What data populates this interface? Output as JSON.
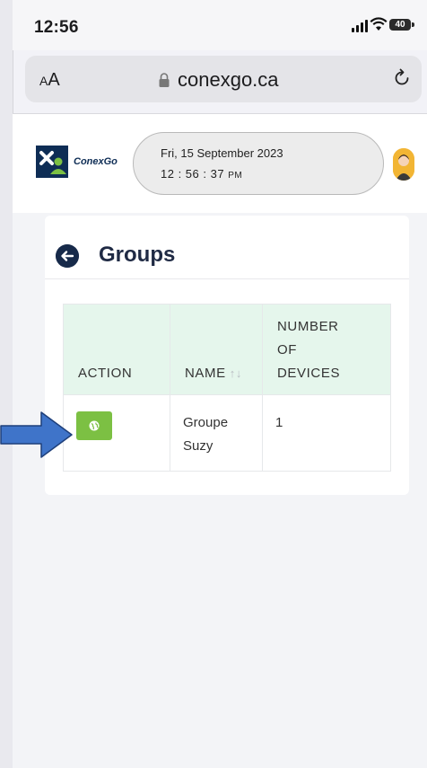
{
  "status_bar": {
    "time": "12:56",
    "battery": "40"
  },
  "browser": {
    "text_size_label_small": "A",
    "text_size_label_large": "A",
    "url": "conexgo.ca"
  },
  "header": {
    "logo_text": "ConexGo",
    "date": "Fri, 15 September 2023",
    "clock": "12 : 56 : 37",
    "meridiem": "PM"
  },
  "page": {
    "title": "Groups",
    "table": {
      "columns": [
        {
          "line1": "ACTION",
          "line2": "",
          "line3": ""
        },
        {
          "line1": "NAME",
          "line2": "",
          "line3": ""
        },
        {
          "line1": "NUMBER",
          "line2": "OF",
          "line3": "DEVICES"
        }
      ],
      "rows": [
        {
          "name_line1": "Groupe",
          "name_line2": "Suzy",
          "devices": "1"
        }
      ]
    }
  },
  "colors": {
    "brand_navy": "#172a4a",
    "header_green": "#e5f6ec",
    "action_green": "#7cc043",
    "annotation_arrow": "#3f74c9"
  },
  "icons": [
    "signal-icon",
    "wifi-icon",
    "battery-icon",
    "lock-icon",
    "reload-icon",
    "back-arrow-icon",
    "sort-icon",
    "globe-icon",
    "pointer-arrow-icon",
    "avatar"
  ]
}
